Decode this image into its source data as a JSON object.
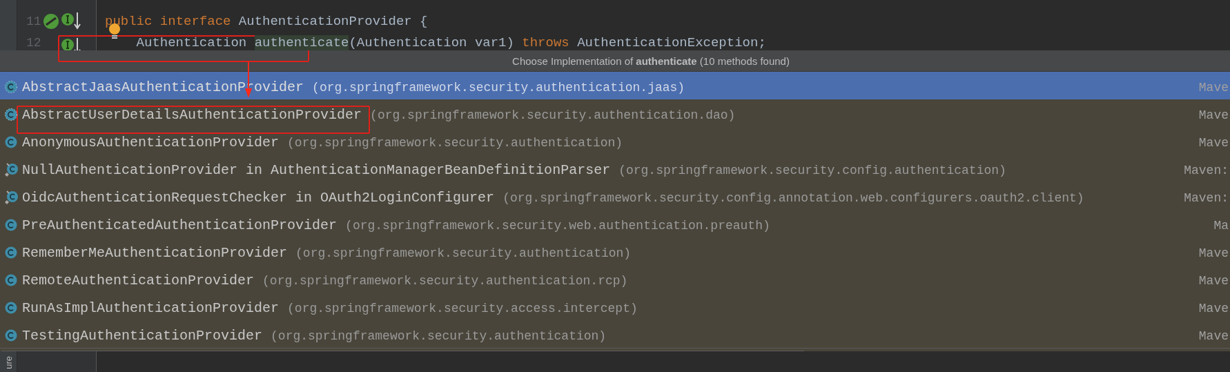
{
  "editor": {
    "lines": [
      {
        "number": "11",
        "implemented": true,
        "has_implementations": true,
        "bulb": false,
        "tokens": [
          {
            "kind": "keyword",
            "text": "public "
          },
          {
            "kind": "keyword",
            "text": "interface"
          },
          {
            "kind": "plain",
            "text": " AuthenticationProvider {"
          }
        ]
      },
      {
        "number": "12",
        "implemented": false,
        "has_implementations": true,
        "bulb": true,
        "tokens": [
          {
            "kind": "plain",
            "text": "    Authentication "
          },
          {
            "kind": "highlighted",
            "text": "authenticate"
          },
          {
            "kind": "plain",
            "text": "(Authentication var1) "
          },
          {
            "kind": "keyword",
            "text": "throws"
          },
          {
            "kind": "plain",
            "text": " AuthenticationException;"
          }
        ]
      }
    ]
  },
  "popup": {
    "title": "Choose Implementation of **authenticate** (10 methods found)",
    "rows": [
      {
        "kind": "abstract",
        "name": "AbstractJaasAuthenticationProvider",
        "package": "(org.springframework.security.authentication.jaas)",
        "library": "Mave",
        "selected": true
      },
      {
        "kind": "abstract",
        "name": "AbstractUserDetailsAuthenticationProvider",
        "package": "(org.springframework.security.authentication.dao)",
        "library": "Mave",
        "selected": false
      },
      {
        "kind": "class",
        "name": "AnonymousAuthenticationProvider",
        "package": "(org.springframework.security.authentication)",
        "library": "Mave",
        "selected": false
      },
      {
        "kind": "inner",
        "name": "NullAuthenticationProvider in AuthenticationManagerBeanDefinitionParser",
        "package": "(org.springframework.security.config.authentication)",
        "library": "Maven:",
        "selected": false
      },
      {
        "kind": "inner",
        "name": "OidcAuthenticationRequestChecker in OAuth2LoginConfigurer",
        "package": "(org.springframework.security.config.annotation.web.configurers.oauth2.client)",
        "library": "Maven:",
        "selected": false
      },
      {
        "kind": "class",
        "name": "PreAuthenticatedAuthenticationProvider",
        "package": "(org.springframework.security.web.authentication.preauth)",
        "library": "Ma",
        "selected": false
      },
      {
        "kind": "class",
        "name": "RememberMeAuthenticationProvider",
        "package": "(org.springframework.security.authentication)",
        "library": "Mave",
        "selected": false
      },
      {
        "kind": "class",
        "name": "RemoteAuthenticationProvider",
        "package": "(org.springframework.security.authentication.rcp)",
        "library": "Mave",
        "selected": false
      },
      {
        "kind": "class",
        "name": "RunAsImplAuthenticationProvider",
        "package": "(org.springframework.security.access.intercept)",
        "library": "Mave",
        "selected": false
      },
      {
        "kind": "class",
        "name": "TestingAuthenticationProvider",
        "package": "(org.springframework.security.authentication)",
        "library": "Mave",
        "selected": false
      }
    ]
  },
  "side_tab": "ure"
}
